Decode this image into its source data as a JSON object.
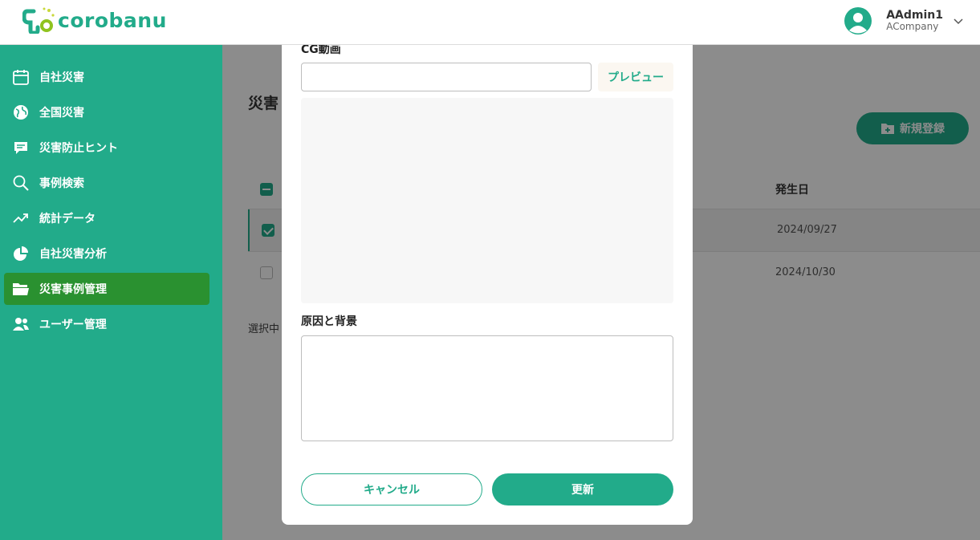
{
  "app": {
    "logo_text": "corobanu",
    "brand_color": "#22ab8a"
  },
  "user": {
    "name": "AAdmin1",
    "company": "ACompany"
  },
  "sidebar": {
    "items": [
      {
        "label": "自社災害",
        "icon": "calendar-icon",
        "active": false
      },
      {
        "label": "全国災害",
        "icon": "globe-icon",
        "active": false
      },
      {
        "label": "災害防止ヒント",
        "icon": "chat-icon",
        "active": false
      },
      {
        "label": "事例検索",
        "icon": "search-icon",
        "active": false
      },
      {
        "label": "統計データ",
        "icon": "trend-icon",
        "active": false
      },
      {
        "label": "自社災害分析",
        "icon": "pie-chart-icon",
        "active": false
      },
      {
        "label": "災害事例管理",
        "icon": "folder-icon",
        "active": true
      },
      {
        "label": "ユーザー管理",
        "icon": "users-icon",
        "active": false
      }
    ],
    "active_color": "#2a9130"
  },
  "main": {
    "title": "災害",
    "new_button_label": "新規登録",
    "table": {
      "date_header": "発生日",
      "rows": [
        {
          "date": "2024/09/27",
          "checked": true
        },
        {
          "date": "2024/10/30",
          "checked": false
        }
      ]
    },
    "selected_note": "選択中"
  },
  "modal": {
    "cg_label": "CG動画",
    "cg_value": "",
    "preview_label": "プレビュー",
    "cause_label": "原因と背景",
    "cause_value": "",
    "cancel_label": "キャンセル",
    "update_label": "更新"
  }
}
